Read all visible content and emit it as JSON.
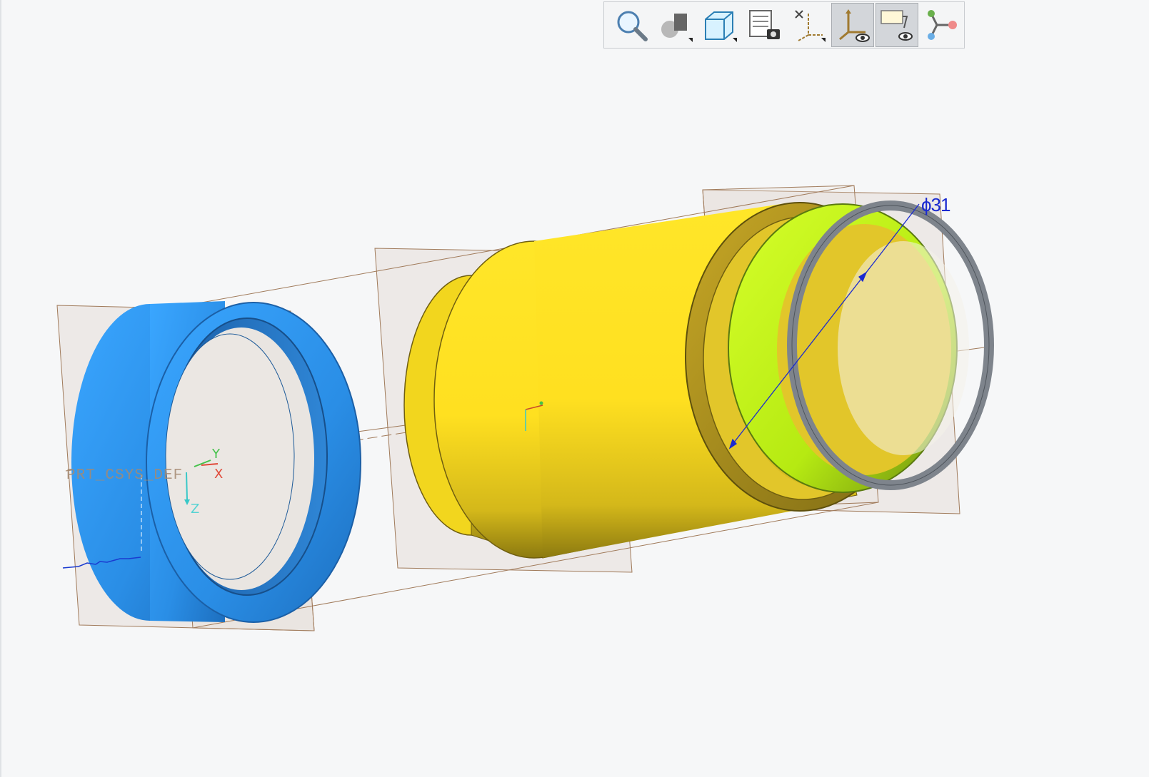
{
  "toolbar": {
    "buttons": [
      {
        "name": "zoom-icon",
        "active": false
      },
      {
        "name": "appearance-icon",
        "active": false
      },
      {
        "name": "display-style-icon",
        "active": false
      },
      {
        "name": "saved-views-icon",
        "active": false
      },
      {
        "name": "datum-display-icon",
        "active": false
      },
      {
        "name": "csys-display-icon",
        "active": true
      },
      {
        "name": "annotation-display-icon",
        "active": true
      },
      {
        "name": "spin-center-icon",
        "active": false
      }
    ]
  },
  "model": {
    "dimension_label": "ϕ31",
    "csys_label": "PRT_CSYS_DEF",
    "axis_labels": {
      "x": "X",
      "y": "Y",
      "z": "Z"
    }
  },
  "colors": {
    "background": "#f6f7f8",
    "blue_ring": "#2f8fde",
    "yellow_body": "#ffe629",
    "green_ring": "#c8ff1a",
    "gray_ring": "#8a9098",
    "datum_plane": "#a07a5a",
    "dimension": "#1a2ad0"
  }
}
